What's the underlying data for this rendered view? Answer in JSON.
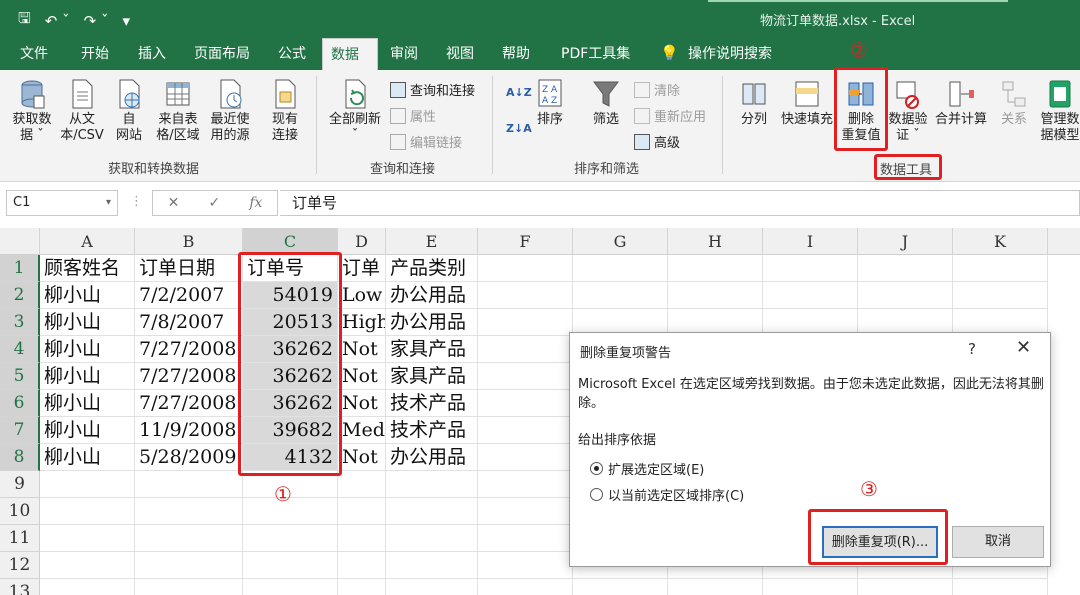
{
  "window": {
    "title": "物流订单数据.xlsx  -  Excel"
  },
  "tabs": [
    "文件",
    "开始",
    "插入",
    "页面布局",
    "公式",
    "数据",
    "审阅",
    "视图",
    "帮助",
    "PDF工具集",
    "操作说明搜索"
  ],
  "active_tab": "数据",
  "ribbon": {
    "get_data_group": {
      "label": "获取和转换数据",
      "buttons": [
        "获取数\n据 ˇ",
        "从文\n本/CSV",
        "自\n网站",
        "来自表\n格/区域",
        "最近使\n用的源",
        "现有\n连接"
      ]
    },
    "query_group": {
      "label": "查询和连接",
      "refresh": "全部刷新\nˇ",
      "items": [
        "查询和连接",
        "属性",
        "编辑链接"
      ]
    },
    "sort_group": {
      "label": "排序和筛选",
      "sort": "排序",
      "filter": "筛选",
      "items": [
        "清除",
        "重新应用",
        "高级"
      ]
    },
    "tools_group": {
      "label": "数据工具",
      "buttons": [
        "分列",
        "快速填充",
        "删除\n重复值",
        "数据验\n证 ˇ",
        "合并计算",
        "关系",
        "管理数\n据模型"
      ]
    }
  },
  "annotations": {
    "one": "①",
    "two": "②",
    "three": "③"
  },
  "formula_bar": {
    "name_box": "C1",
    "fx": "fx",
    "formula": "订单号"
  },
  "columns": [
    "A",
    "B",
    "C",
    "D",
    "E",
    "F",
    "G",
    "H",
    "I",
    "J",
    "K"
  ],
  "rows": [
    "1",
    "2",
    "3",
    "4",
    "5",
    "6",
    "7",
    "8",
    "9",
    "10",
    "11",
    "12",
    "13"
  ],
  "cells": [
    [
      "顾客姓名",
      "订单日期",
      "订单号",
      "订单",
      "产品类别"
    ],
    [
      "柳小山",
      "7/2/2007",
      "54019",
      "Low",
      "办公用品"
    ],
    [
      "柳小山",
      "7/8/2007",
      "20513",
      "High",
      "办公用品"
    ],
    [
      "柳小山",
      "7/27/2008",
      "36262",
      "Not",
      "家具产品"
    ],
    [
      "柳小山",
      "7/27/2008",
      "36262",
      "Not",
      "家具产品"
    ],
    [
      "柳小山",
      "7/27/2008",
      "36262",
      "Not",
      "技术产品"
    ],
    [
      "柳小山",
      "11/9/2008",
      "39682",
      "Medi",
      "技术产品"
    ],
    [
      "柳小山",
      "5/28/2009",
      "4132",
      "Not",
      "办公用品"
    ]
  ],
  "dialog": {
    "title": "删除重复项警告",
    "help": "?",
    "close": "✕",
    "message": "Microsoft Excel 在选定区域旁找到数据。由于您未选定此数据，因此无法将其删除。",
    "legend": "给出排序依据",
    "option1": "扩展选定区域(E)",
    "option2": "以当前选定区域排序(C)",
    "primary_button": "删除重复项(R)...",
    "cancel_button": "取消"
  }
}
